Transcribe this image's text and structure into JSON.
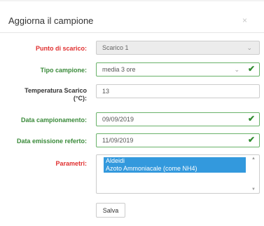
{
  "modal": {
    "title": "Aggiorna il campione",
    "close": "×"
  },
  "form": {
    "punto_scarico": {
      "label": "Punto di scarico:",
      "value": "Scarico 1"
    },
    "tipo_campione": {
      "label": "Tipo campione:",
      "value": "media 3 ore"
    },
    "temperatura": {
      "label_line1": "Temperatura Scarico",
      "label_line2": "(°C):",
      "value": "13"
    },
    "data_campionamento": {
      "label": "Data campionamento:",
      "value": "09/09/2019"
    },
    "data_emissione": {
      "label": "Data emissione referto:",
      "value": "11/09/2019"
    },
    "parametri": {
      "label": "Parametri:",
      "selected": [
        "Aldeidi",
        "Azoto Ammoniacale (come NH4)"
      ]
    },
    "save_label": "Salva"
  },
  "icons": {
    "chevron": "chevron-down-icon",
    "check": "check-icon",
    "close": "close-icon"
  },
  "colors": {
    "required_label": "#e02f2f",
    "valid_label": "#3a8a3a",
    "selection": "#3399dd",
    "valid_border": "#6ab26a"
  }
}
